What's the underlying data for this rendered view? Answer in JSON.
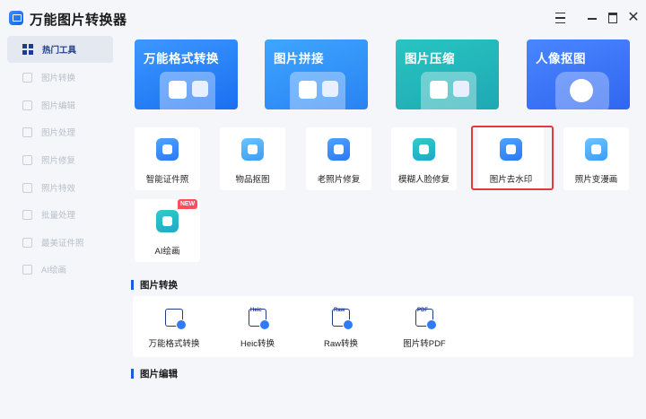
{
  "app": {
    "title": "万能图片转换器"
  },
  "sidebar": {
    "items": [
      {
        "label": "热门工具",
        "active": true
      },
      {
        "label": "图片转换"
      },
      {
        "label": "图片编辑"
      },
      {
        "label": "图片处理"
      },
      {
        "label": "照片修复"
      },
      {
        "label": "照片特效"
      },
      {
        "label": "批量处理"
      },
      {
        "label": "最美证件照"
      },
      {
        "label": "AI绘画"
      }
    ]
  },
  "banners": [
    {
      "label": "万能格式转换",
      "icon": "image-convert-icon"
    },
    {
      "label": "图片拼接",
      "icon": "image-stitch-icon"
    },
    {
      "label": "图片压缩",
      "icon": "image-compress-icon"
    },
    {
      "label": "人像抠图",
      "icon": "portrait-cutout-icon"
    }
  ],
  "tools": [
    {
      "label": "智能证件照",
      "icon": "id-photo-icon"
    },
    {
      "label": "物品抠图",
      "icon": "object-cutout-icon"
    },
    {
      "label": "老照片修复",
      "icon": "old-photo-repair-icon"
    },
    {
      "label": "模糊人脸修复",
      "icon": "face-restore-icon"
    },
    {
      "label": "图片去水印",
      "icon": "watermark-remove-icon",
      "highlighted": true
    },
    {
      "label": "照片变漫画",
      "icon": "cartoon-icon"
    },
    {
      "label": "AI绘画",
      "icon": "ai-paint-icon",
      "badge": "NEW"
    }
  ],
  "sections": {
    "convert_title": "图片转换",
    "edit_title": "图片编辑"
  },
  "convert_items": [
    {
      "label": "万能格式转换",
      "tag": ""
    },
    {
      "label": "Heic转换",
      "tag": "Heic"
    },
    {
      "label": "Raw转换",
      "tag": "Raw"
    },
    {
      "label": "图片转PDF",
      "tag": "PDF"
    }
  ],
  "colors": {
    "accent": "#1e5bdc",
    "highlight_border": "#e03a3a",
    "badge": "#ff4d5a"
  }
}
